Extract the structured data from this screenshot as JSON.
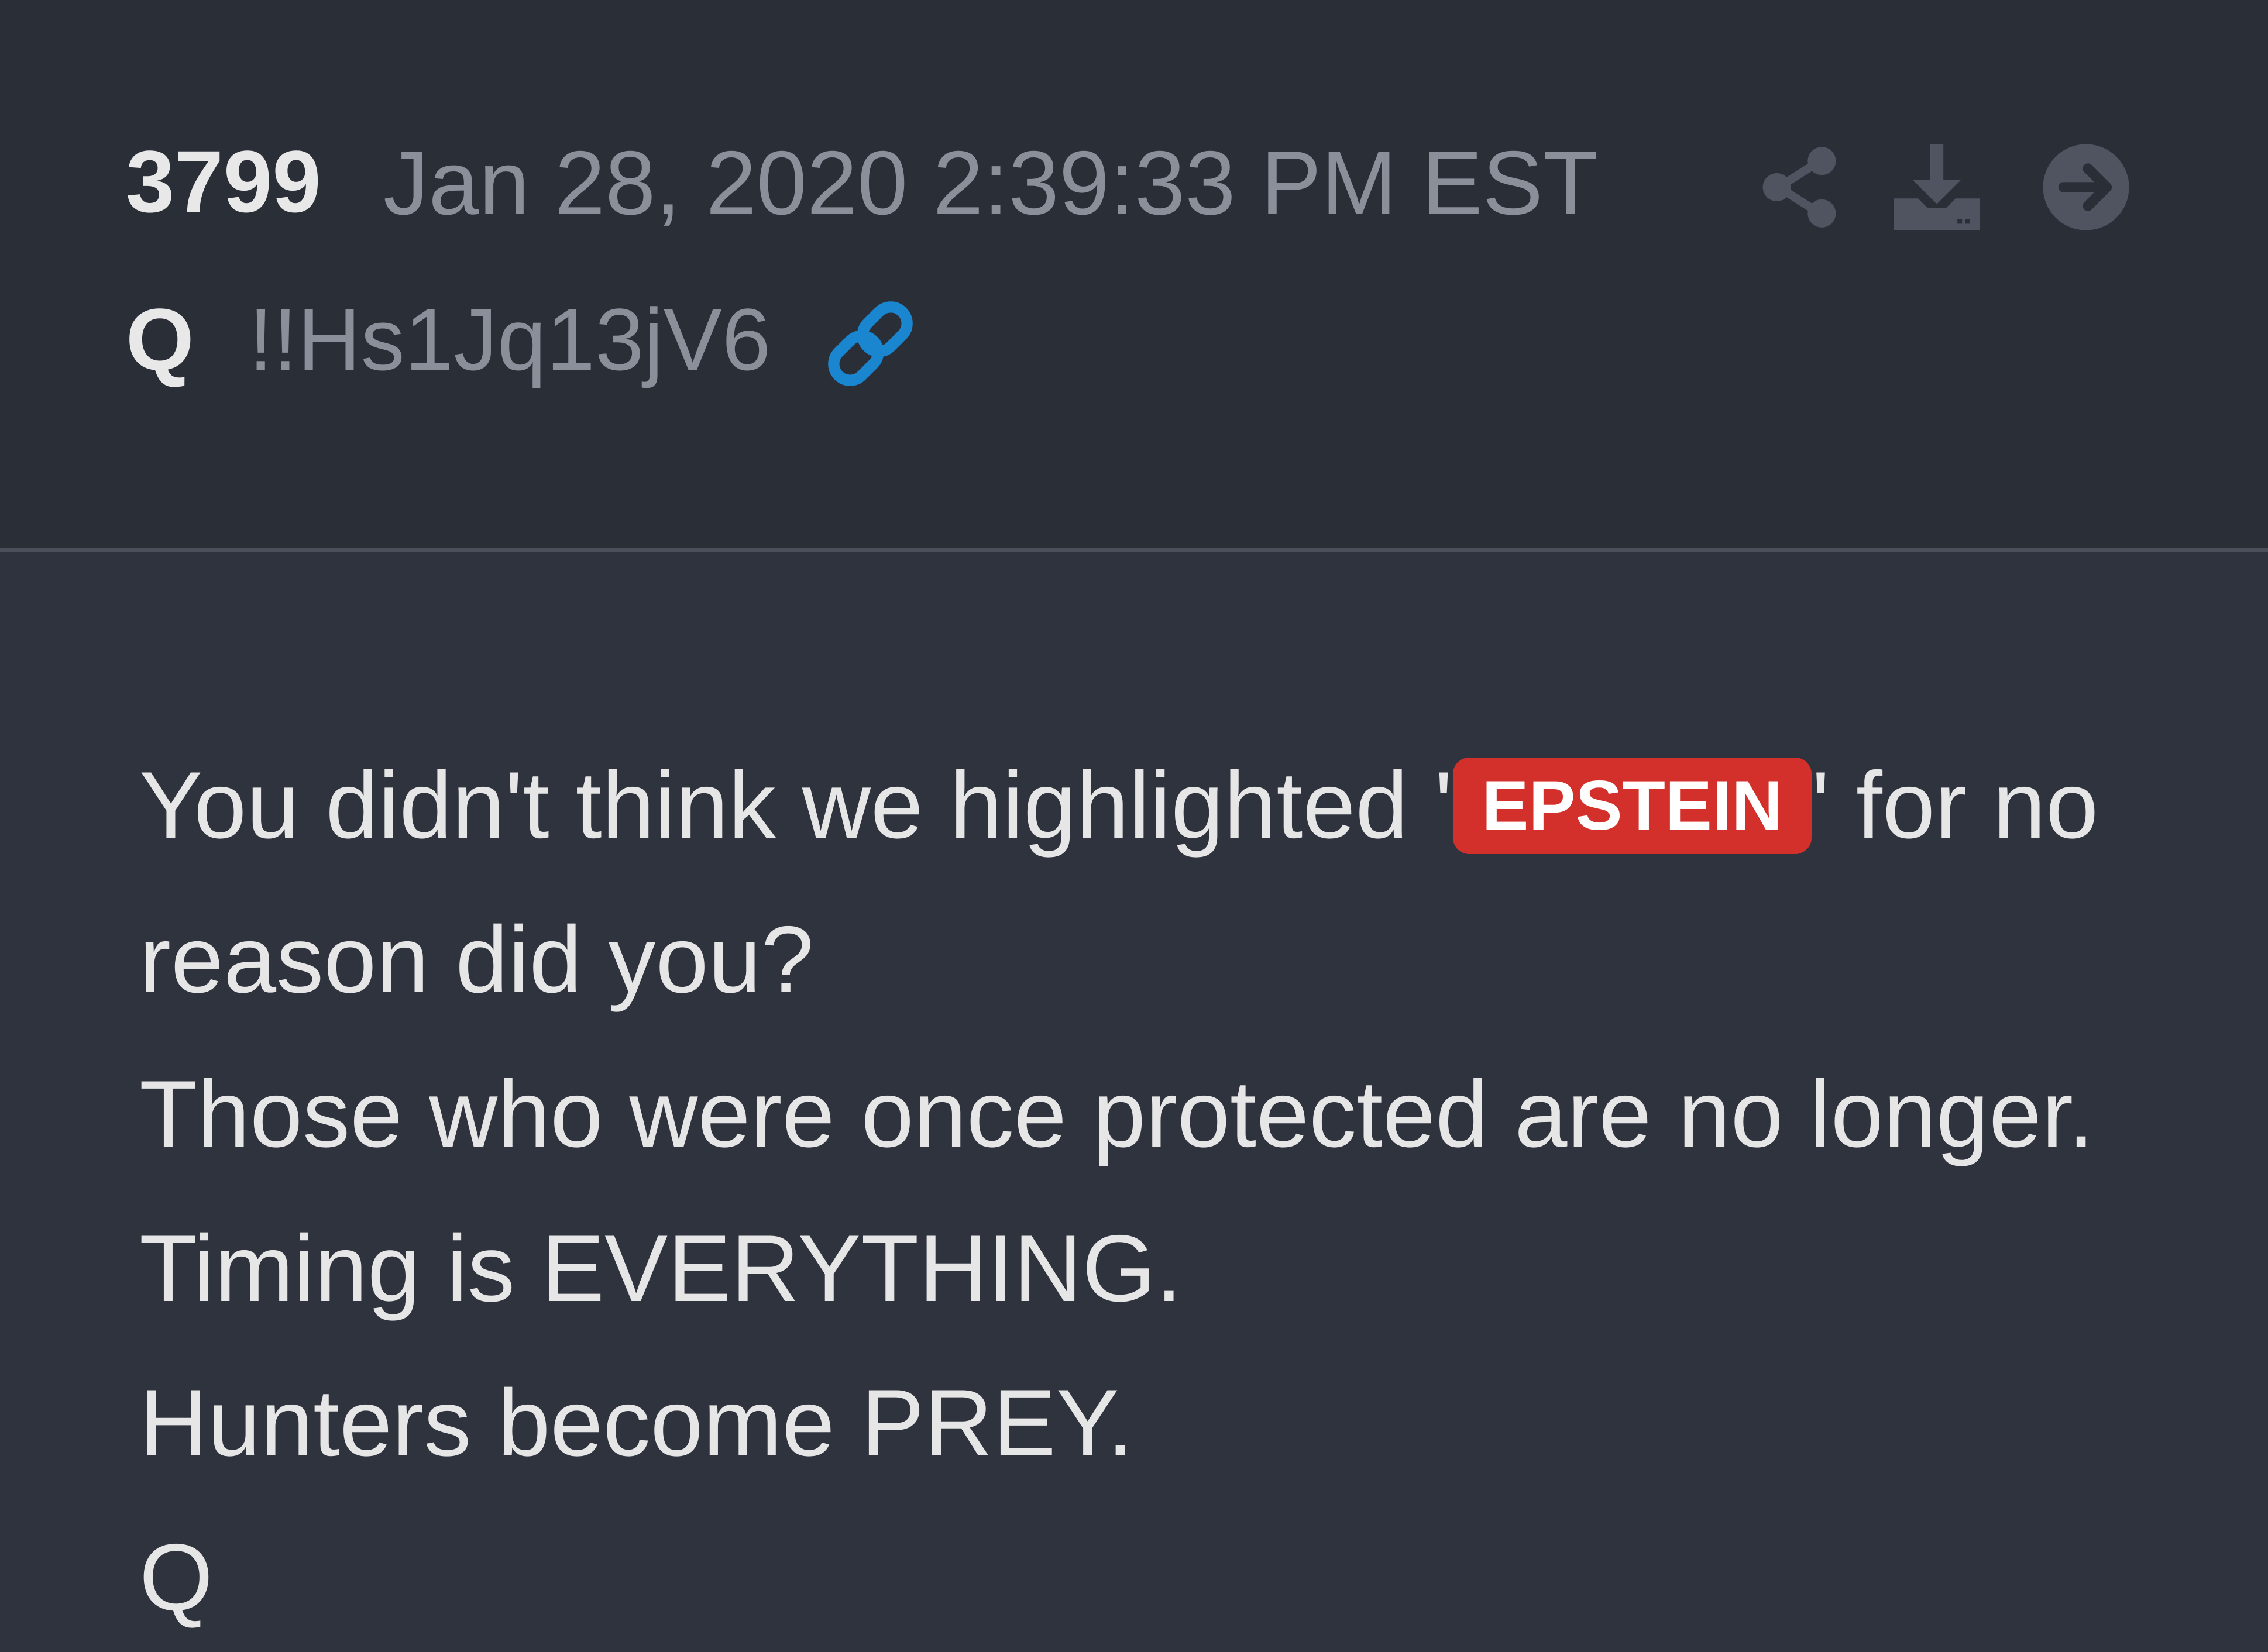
{
  "post": {
    "number": "3799",
    "date": "Jan 28, 2020 2:39:33 PM EST",
    "author": "Q",
    "tripcode": "!!Hs1Jq13jV6"
  },
  "icons": {
    "link": "link-icon",
    "share": "share-icon",
    "download": "download-icon",
    "goto": "arrow-right-circle-icon"
  },
  "colors": {
    "header_bg": "#2a2e37",
    "body_bg": "#2f333d",
    "tag_bg": "#d4302b",
    "link_icon": "#1a86d0",
    "muted_text": "#8a8f9a"
  },
  "message": {
    "line1_before": "You didn't think we highlighted '",
    "tag": "EPSTEIN",
    "line1_after": "' for no",
    "line2": "reason did you?",
    "line3": "Those who were once protected are no longer.",
    "line4": "Timing is EVERYTHING.",
    "line5": "Hunters become PREY.",
    "line6": "Q"
  }
}
